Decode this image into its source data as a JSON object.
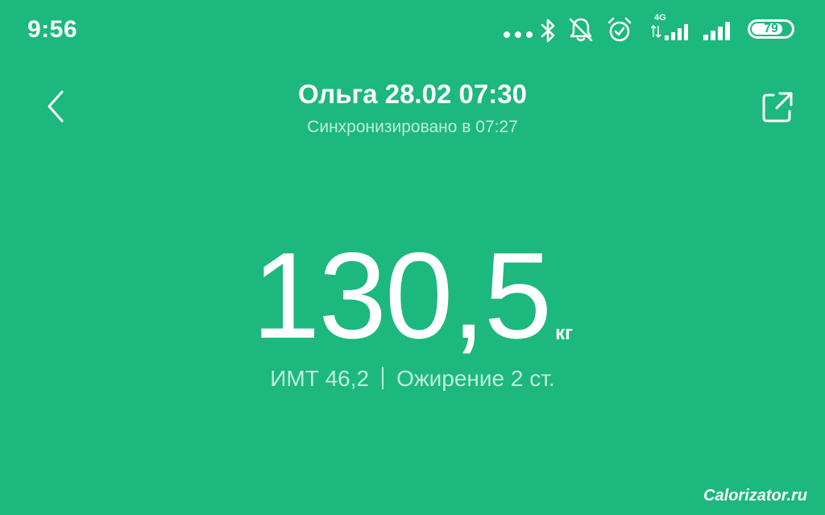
{
  "status_bar": {
    "time": "9:56",
    "network_label": "4G",
    "battery_level": "79",
    "battery_fraction": 0.79,
    "icons": [
      "more-dots-icon",
      "bluetooth-icon",
      "notifications-off-icon",
      "alarm-icon",
      "signal-4g-icon",
      "signal-icon",
      "battery-icon"
    ]
  },
  "header": {
    "title": "Ольга 28.02 07:30",
    "subtitle": "Синхронизировано в 07:27",
    "back_icon": "chevron-left-icon",
    "share_icon": "share-icon"
  },
  "measurement": {
    "weight": "130,5",
    "unit": "кг",
    "bmi": "ИМТ 46,2",
    "category": "Ожирение 2 ст."
  },
  "watermark": "Calorizator.ru",
  "colors": {
    "background": "#1cb87e",
    "text": "#ffffff",
    "muted_text": "#bfeedb"
  }
}
